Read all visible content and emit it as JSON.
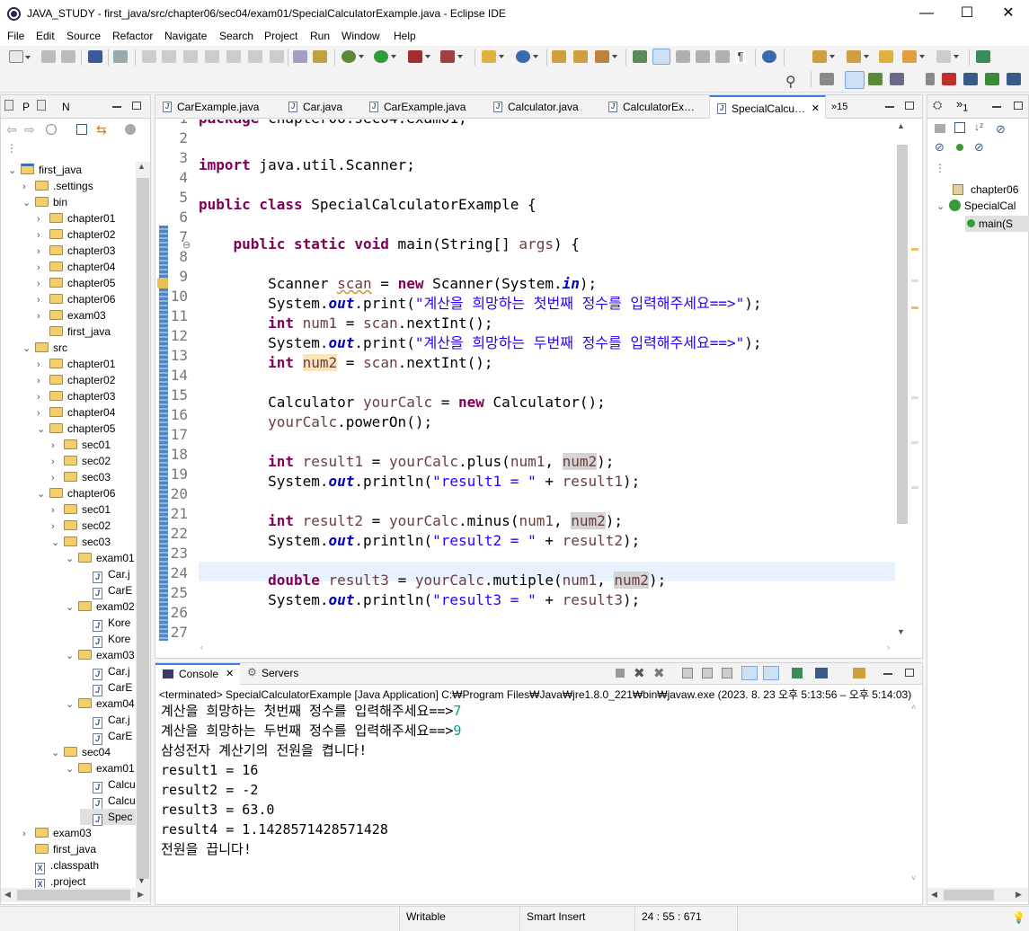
{
  "window": {
    "title": "JAVA_STUDY - first_java/src/chapter06/sec04/exam01/SpecialCalculatorExample.java - Eclipse IDE",
    "minimize": "—",
    "maximize": "☐",
    "close": "✕"
  },
  "menu": [
    "File",
    "Edit",
    "Source",
    "Refactor",
    "Navigate",
    "Search",
    "Project",
    "Run",
    "Window",
    "Help"
  ],
  "left_panel": {
    "tabs": [
      "P",
      "N"
    ],
    "tree": [
      {
        "label": "first_java",
        "type": "project",
        "depth": 0,
        "open": true
      },
      {
        "label": ".settings",
        "type": "folder",
        "depth": 1,
        "open": false
      },
      {
        "label": "bin",
        "type": "folder",
        "depth": 1,
        "open": true
      },
      {
        "label": "chapter01",
        "type": "folder",
        "depth": 2,
        "open": false
      },
      {
        "label": "chapter02",
        "type": "folder",
        "depth": 2,
        "open": false
      },
      {
        "label": "chapter03",
        "type": "folder",
        "depth": 2,
        "open": false
      },
      {
        "label": "chapter04",
        "type": "folder",
        "depth": 2,
        "open": false
      },
      {
        "label": "chapter05",
        "type": "folder",
        "depth": 2,
        "open": false
      },
      {
        "label": "chapter06",
        "type": "folder",
        "depth": 2,
        "open": false
      },
      {
        "label": "exam03",
        "type": "folder",
        "depth": 2,
        "open": false
      },
      {
        "label": "first_java",
        "type": "folder",
        "depth": 2,
        "open": null
      },
      {
        "label": "src",
        "type": "folder",
        "depth": 1,
        "open": true
      },
      {
        "label": "chapter01",
        "type": "folder",
        "depth": 2,
        "open": false
      },
      {
        "label": "chapter02",
        "type": "folder",
        "depth": 2,
        "open": false
      },
      {
        "label": "chapter03",
        "type": "folder",
        "depth": 2,
        "open": false
      },
      {
        "label": "chapter04",
        "type": "folder",
        "depth": 2,
        "open": false
      },
      {
        "label": "chapter05",
        "type": "folder",
        "depth": 2,
        "open": true
      },
      {
        "label": "sec01",
        "type": "folder",
        "depth": 3,
        "open": false
      },
      {
        "label": "sec02",
        "type": "folder",
        "depth": 3,
        "open": false
      },
      {
        "label": "sec03",
        "type": "folder",
        "depth": 3,
        "open": false
      },
      {
        "label": "chapter06",
        "type": "folder",
        "depth": 2,
        "open": true
      },
      {
        "label": "sec01",
        "type": "folder",
        "depth": 3,
        "open": false
      },
      {
        "label": "sec02",
        "type": "folder",
        "depth": 3,
        "open": false
      },
      {
        "label": "sec03",
        "type": "folder",
        "depth": 3,
        "open": true
      },
      {
        "label": "exam01",
        "type": "folder",
        "depth": 4,
        "open": true
      },
      {
        "label": "Car.j",
        "type": "java",
        "depth": 5,
        "open": null
      },
      {
        "label": "CarE",
        "type": "java",
        "depth": 5,
        "open": null
      },
      {
        "label": "exam02",
        "type": "folder",
        "depth": 4,
        "open": true
      },
      {
        "label": "Kore",
        "type": "java",
        "depth": 5,
        "open": null
      },
      {
        "label": "Kore",
        "type": "java",
        "depth": 5,
        "open": null
      },
      {
        "label": "exam03",
        "type": "folder",
        "depth": 4,
        "open": true
      },
      {
        "label": "Car.j",
        "type": "java",
        "depth": 5,
        "open": null
      },
      {
        "label": "CarE",
        "type": "java",
        "depth": 5,
        "open": null
      },
      {
        "label": "exam04",
        "type": "folder",
        "depth": 4,
        "open": true
      },
      {
        "label": "Car.j",
        "type": "java",
        "depth": 5,
        "open": null
      },
      {
        "label": "CarE",
        "type": "java",
        "depth": 5,
        "open": null
      },
      {
        "label": "sec04",
        "type": "folder",
        "depth": 3,
        "open": true
      },
      {
        "label": "exam01",
        "type": "folder",
        "depth": 4,
        "open": true
      },
      {
        "label": "Calcu",
        "type": "java",
        "depth": 5,
        "open": null
      },
      {
        "label": "Calcu",
        "type": "java",
        "depth": 5,
        "open": null
      },
      {
        "label": "Spec",
        "type": "java",
        "depth": 5,
        "open": null,
        "selected": true
      },
      {
        "label": "exam03",
        "type": "folder",
        "depth": 1,
        "open": false
      },
      {
        "label": "first_java",
        "type": "folder",
        "depth": 1,
        "open": null
      },
      {
        "label": ".classpath",
        "type": "xml",
        "depth": 1,
        "open": null
      },
      {
        "label": ".project",
        "type": "xml",
        "depth": 1,
        "open": null
      }
    ]
  },
  "editor": {
    "tabs": [
      "CarExample.java",
      "Car.java",
      "CarExample.java",
      "Calculator.java",
      "CalculatorEx…",
      "SpecialCalcu…"
    ],
    "overflow_count": "»15",
    "active_tab": 5,
    "line_numbers": [
      "1",
      "2",
      "3",
      "4",
      "5",
      "6",
      "7",
      "8",
      "9",
      "10",
      "11",
      "12",
      "13",
      "14",
      "15",
      "16",
      "17",
      "18",
      "19",
      "20",
      "21",
      "22",
      "23",
      "24",
      "25",
      "26",
      "27"
    ]
  },
  "console": {
    "tabs": [
      "Console",
      "Servers"
    ],
    "header": "<terminated> SpecialCalculatorExample [Java Application] C:₩Program Files₩Java₩jre1.8.0_221₩bin₩javaw.exe  (2023. 8. 23 오후 5:13:56 – 오후 5:14:03)",
    "lines": [
      {
        "text": "계산을 희망하는 첫번째 정수를 입력해주세요==>",
        "input": "7"
      },
      {
        "text": "계산을 희망하는 두번째 정수를 입력해주세요==>",
        "input": "9"
      },
      {
        "text": "삼성전자 계산기의 전원을 켭니다!",
        "input": ""
      },
      {
        "text": "result1 = 16",
        "input": ""
      },
      {
        "text": "result2 = -2",
        "input": ""
      },
      {
        "text": "result3 = 63.0",
        "input": ""
      },
      {
        "text": "result4 = 1.1428571428571428",
        "input": ""
      },
      {
        "text": "전원을 끕니다!",
        "input": ""
      }
    ]
  },
  "outline": {
    "tabs": [
      "",
      "1"
    ],
    "items": [
      "chapter06",
      "SpecialCal",
      "main(S"
    ]
  },
  "status": {
    "mode": "Writable",
    "insert": "Smart Insert",
    "position": "24 : 55 : 671"
  },
  "colors": {
    "keyword": "#7f0055",
    "string": "#2a00ff",
    "static_field": "#0000c0",
    "local_var": "#6a3e3e",
    "console_input": "#00a58a",
    "active_tab_accent": "#3f7fe0"
  }
}
